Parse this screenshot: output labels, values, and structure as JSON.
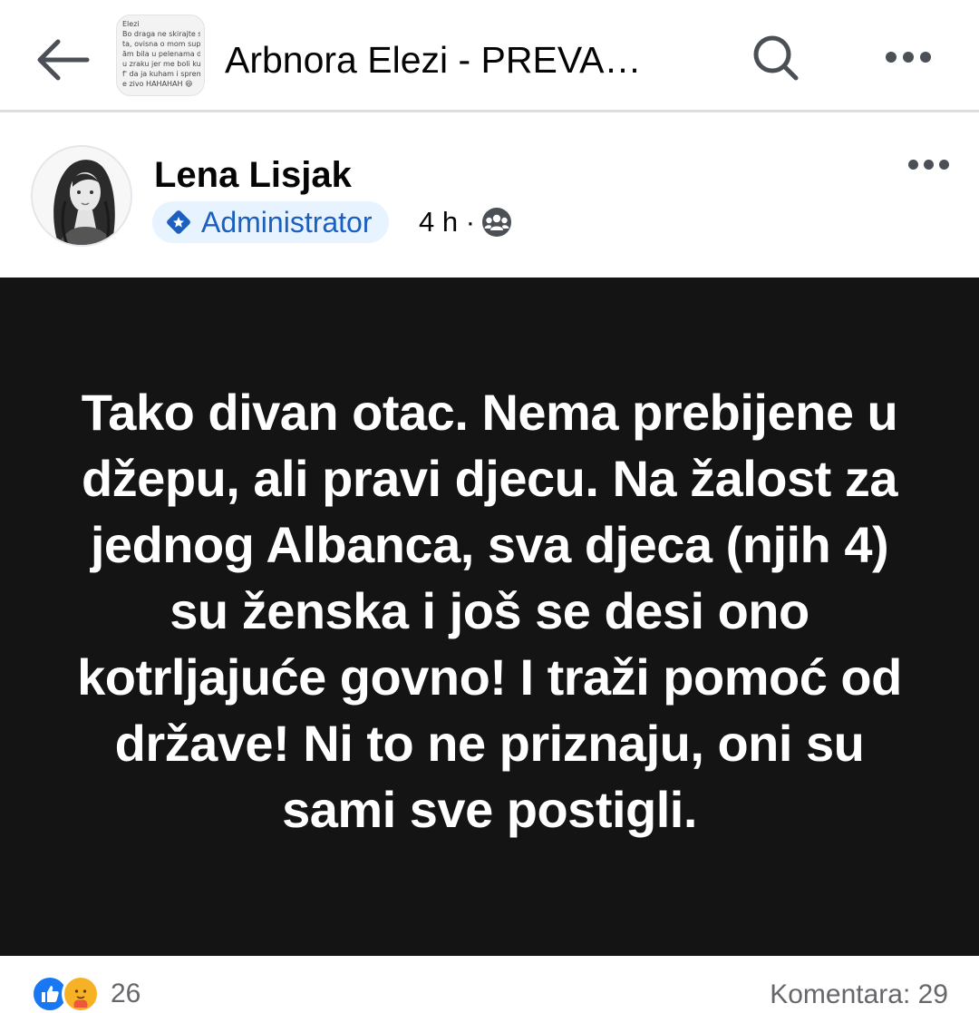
{
  "topbar": {
    "title": "Arbnora Elezi - PREVA…",
    "thumbnail_lines": [
      "Elezi",
      "Bo draga ne skirajte se",
      "ta, ovisna o mom supr",
      "ām bila u pelenama do",
      "u zraku jer me boli ku",
      "f' da ja kuham i spremi",
      "e zivo HAHAHAH 😆"
    ]
  },
  "post": {
    "author": "Lena Lisjak",
    "badge": "Administrator",
    "time": "4 h ·",
    "text": "Tako divan otac. Nema prebijene u džepu, ali pravi djecu. Na žalost za jednog Albanca, sva djeca (njih 4) su ženska i još se desi ono kotrljajuće govno! I traži pomoć od države! Ni to ne priznaju, oni su sami sve postigli.",
    "background_color": "#141414",
    "text_color": "#ffffff"
  },
  "footer": {
    "reactions_count": "26",
    "comments": "Komentara: 29"
  },
  "icons": {
    "back": "arrow-left-icon",
    "search": "search-icon",
    "more": "more-horizontal-icon",
    "badge": "admin-diamond-icon",
    "audience": "group-audience-icon",
    "like": "like-reaction-icon",
    "care": "care-reaction-icon"
  },
  "colors": {
    "accent": "#1877f2",
    "badge_bg": "#e7f3ff",
    "badge_text": "#1b5fbf"
  }
}
